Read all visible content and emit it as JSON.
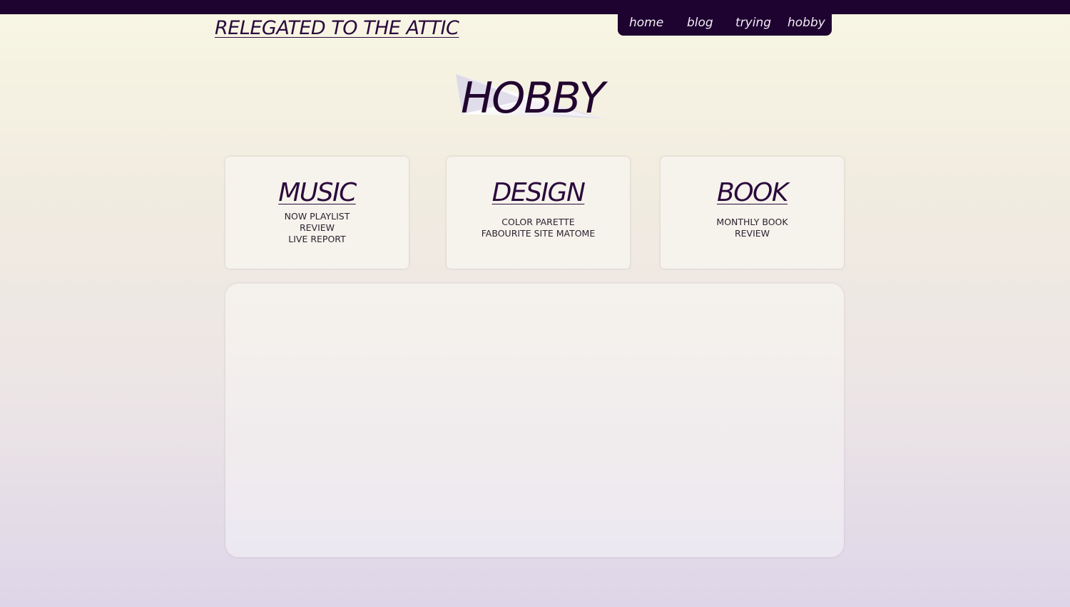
{
  "site": {
    "title": "RELEGATED TO THE ATTIC"
  },
  "nav": {
    "items": [
      {
        "label": "home"
      },
      {
        "label": "blog"
      },
      {
        "label": "trying"
      },
      {
        "label": "hobby"
      }
    ]
  },
  "page": {
    "heading": "HOBBY"
  },
  "cards": [
    {
      "title": "MUSIC",
      "links": [
        "NOW PLAYLIST",
        "REVIEW",
        "LIVE REPORT"
      ]
    },
    {
      "title": "DESIGN",
      "links": [
        "COLOR PARETTE",
        "FABOURITE SITE MATOME"
      ]
    },
    {
      "title": "BOOK",
      "links": [
        "MONTHLY BOOK",
        "REVIEW"
      ]
    }
  ],
  "colors": {
    "top_bar": "#1e0230",
    "nav_background": "#1e0230",
    "text_dark": "#2b0a3c",
    "card_background": "#f6f3ec"
  }
}
